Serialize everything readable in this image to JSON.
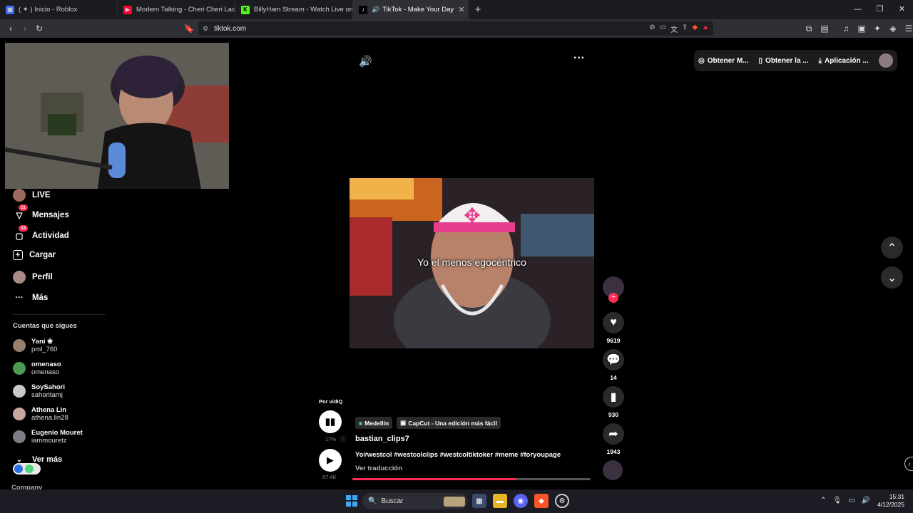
{
  "browser": {
    "tabs": [
      {
        "label": "( ✦ ) Inicio - Roblox",
        "fav": "roblox-icon",
        "color": "#3a6cf4"
      },
      {
        "label": "Modern Talking - Cheri Cheri Lady (C",
        "fav": "youtube-icon",
        "color": "#ff0033"
      },
      {
        "label": "BillyHam Stream - Watch Live on Kick",
        "fav": "kick-icon",
        "color": "#53fc18"
      },
      {
        "label": "TikTok - Make Your Day",
        "fav": "tiktok-icon",
        "color": "#ffffff",
        "active": true
      }
    ],
    "url": "tiktok.com",
    "window_controls": [
      "—",
      "❐",
      "✕"
    ]
  },
  "header": {
    "buttons": [
      {
        "label": "Obtener M..."
      },
      {
        "label": "Obtener la ..."
      },
      {
        "label": "Aplicación ..."
      }
    ]
  },
  "sidebar": {
    "nav": [
      {
        "label": "LIVE",
        "icon": "live-icon"
      },
      {
        "label": "Mensajes",
        "icon": "message-icon",
        "badge": "11"
      },
      {
        "label": "Actividad",
        "icon": "activity-icon",
        "badge": "33"
      },
      {
        "label": "Cargar",
        "icon": "upload-icon"
      },
      {
        "label": "Perfil",
        "icon": "profile-icon"
      },
      {
        "label": "Más",
        "icon": "more-icon"
      }
    ],
    "following_title": "Cuentas que sigues",
    "following": [
      {
        "name": "Yani ❀",
        "handle": "pml_760",
        "color": "#9a7f6a"
      },
      {
        "name": "omenaso",
        "handle": "omenaso",
        "color": "#4d9a54"
      },
      {
        "name": "SoySahori",
        "handle": "sahoritamj",
        "color": "#c9c9c9"
      },
      {
        "name": "Athena Lin",
        "handle": "athena.lin28",
        "color": "#c9a7a0"
      },
      {
        "name": "Eugenio Mouret",
        "handle": "iammouretz",
        "color": "#7d7d85"
      }
    ],
    "see_more": "Ver más",
    "company": "Company"
  },
  "video": {
    "caption": "Yo el menos egocéntrico",
    "username": "bastian_clips7",
    "description": "Yo#westcol #westcolclips #westcoltiktoker #meme #foryoupage",
    "translate": "Ver traducción",
    "tags": [
      "Medellín",
      "CapCut - Una edición más fácil"
    ],
    "progress": 0.69
  },
  "vidiq": {
    "title": "Por vidIQ",
    "percent": "17%",
    "views": "67.4K"
  },
  "actions": {
    "likes": "9619",
    "comments": "14",
    "saves": "930",
    "shares": "1943"
  },
  "taskbar": {
    "search_placeholder": "Buscar",
    "time": "15:31",
    "date": "4/12/2025"
  }
}
